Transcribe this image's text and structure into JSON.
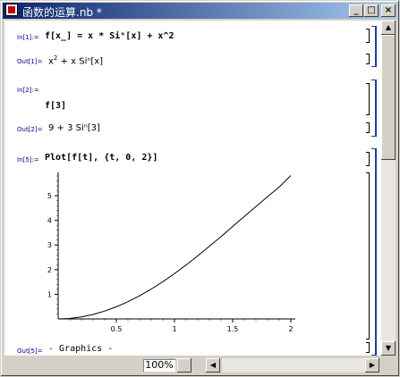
{
  "window": {
    "title": "函数的运算.nb *",
    "minimize_glyph": "_",
    "maximize_glyph": "□",
    "close_glyph": "×"
  },
  "cells": {
    "in1": {
      "label": "In[1]:=",
      "text": "f[x_] = x * Siⁿ[x] + x^2"
    },
    "out1": {
      "label": "Out[1]=",
      "base": "x",
      "sup": "2",
      "rest": " + x Siⁿ[x]"
    },
    "in2": {
      "label": "In[2]:=",
      "text": "f[3]"
    },
    "out2": {
      "label": "Out[2]=",
      "text": "9 + 3 Siⁿ[3]"
    },
    "in5": {
      "label": "In[5]:=",
      "text": "Plot[f[t], {t, 0, 2}]"
    },
    "out5": {
      "label": "Out[5]=",
      "text": "- Graphics -"
    }
  },
  "chart_data": {
    "type": "line",
    "x_range": [
      0,
      2
    ],
    "y_range": [
      0,
      6
    ],
    "x_ticks": [
      "0.5",
      "1",
      "1.5",
      "2"
    ],
    "y_ticks": [
      "1",
      "2",
      "3",
      "4",
      "5"
    ],
    "function": "t^2 + t*sin(t)",
    "x": [
      0,
      0.1,
      0.2,
      0.3,
      0.4,
      0.5,
      0.6,
      0.7,
      0.8,
      0.9,
      1.0,
      1.1,
      1.2,
      1.3,
      1.4,
      1.5,
      1.6,
      1.7,
      1.8,
      1.9,
      2.0
    ],
    "y": [
      0,
      0.02,
      0.08,
      0.18,
      0.32,
      0.49,
      0.7,
      0.94,
      1.21,
      1.51,
      1.84,
      2.19,
      2.56,
      2.95,
      3.34,
      3.75,
      4.16,
      4.56,
      4.96,
      5.35,
      5.82
    ]
  },
  "statusbar": {
    "zoom": "100%",
    "left_arrow": "◀",
    "right_arrow": "▶"
  },
  "scrollbar": {
    "up_arrow": "▲",
    "down_arrow": "▼"
  }
}
